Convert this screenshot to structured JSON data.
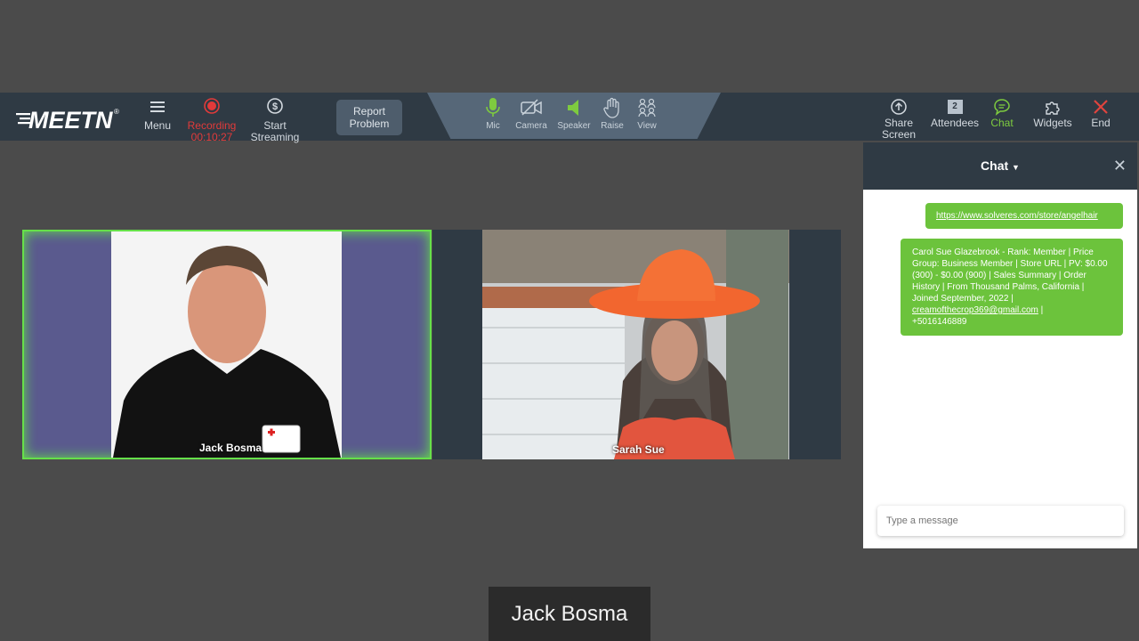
{
  "toolbar": {
    "logo": "MEETN",
    "logo_mark": "®",
    "menu": "Menu",
    "recording": "Recording",
    "recording_time": "00:10:27",
    "streaming_line1": "Start",
    "streaming_line2": "Streaming",
    "report_line1": "Report",
    "report_line2": "Problem",
    "center": [
      "Mic",
      "Camera",
      "Speaker",
      "Raise",
      "View"
    ],
    "share_line1": "Share",
    "share_line2": "Screen",
    "attendees": "Attendees",
    "attendee_count": "2",
    "chat": "Chat",
    "widgets": "Widgets",
    "end": "End"
  },
  "participants": [
    {
      "name": "Jack Bosma"
    },
    {
      "name": "Sarah Sue"
    }
  ],
  "chat": {
    "title": "Chat",
    "messages": [
      {
        "link": "https://www.solveres.com/store/angelhair"
      },
      {
        "text": "Carol Sue Glazebrook - Rank: Member | Price Group: Business Member | Store URL | PV:  $0.00 (300)  -  $0.00 (900)  | Sales Summary | Order History | From Thousand Palms, California | Joined September, 2022 |",
        "email": "creamofthecrop369@gmail.com",
        "email_suffix": " |",
        "phone": "+5016146889"
      }
    ],
    "placeholder": "Type a message"
  },
  "active_speaker": "Jack Bosma",
  "colors": {
    "toolbar": "#2f3a44",
    "accent_green": "#6cc33c",
    "recording_red": "#e23a3a",
    "end_red": "#e0443e"
  }
}
